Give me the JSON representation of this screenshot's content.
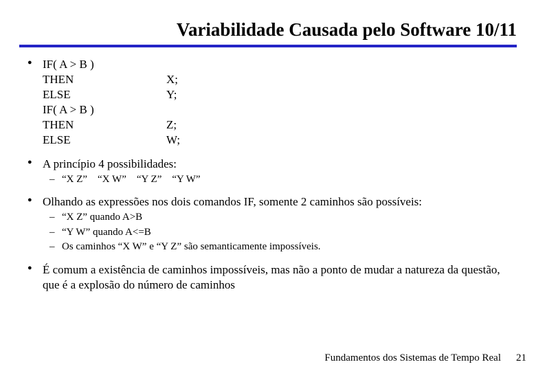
{
  "title": "Variabilidade Causada pelo Software 10/11",
  "code": {
    "r1": {
      "l": "IF( A > B )",
      "r": ""
    },
    "r2": {
      "l": "THEN",
      "r": "X;"
    },
    "r3": {
      "l": "ELSE",
      "r": "Y;"
    },
    "r4": {
      "l": "IF( A > B )",
      "r": ""
    },
    "r5": {
      "l": "THEN",
      "r": "Z;"
    },
    "r6": {
      "l": "ELSE",
      "r": "W;"
    }
  },
  "bullets": {
    "b2": "A princípio 4 possibilidades:",
    "b2_sub1": "“X Z” “X W” “Y Z” “Y W”",
    "b3": "Olhando as expressões nos dois comandos IF, somente 2 caminhos são possíveis:",
    "b3_sub1": "“X Z” quando A>B",
    "b3_sub2": "“Y W” quando A<=B",
    "b3_sub3": "Os caminhos “X W” e “Y Z” são semanticamente impossíveis.",
    "b4": "É comum a existência de caminhos impossíveis, mas não a ponto de mudar a natureza da questão, que é a explosão do número de caminhos"
  },
  "footer": "Fundamentos dos Sistemas de Tempo Real",
  "page_number": "21"
}
